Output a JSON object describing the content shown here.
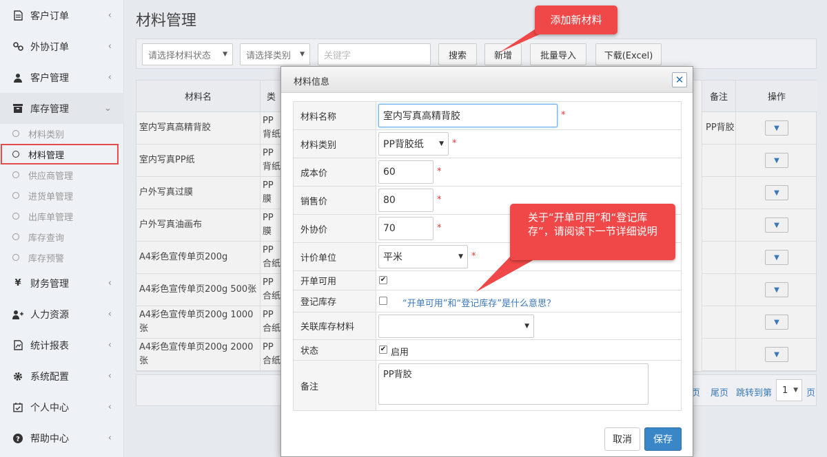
{
  "sidebar": {
    "items": [
      {
        "label": "客户订单",
        "icon": "document-icon"
      },
      {
        "label": "外协订单",
        "icon": "link-icon"
      },
      {
        "label": "客户管理",
        "icon": "user-icon"
      },
      {
        "label": "库存管理",
        "icon": "inventory-icon"
      },
      {
        "label": "财务管理",
        "icon": "yen-icon"
      },
      {
        "label": "人力资源",
        "icon": "user-add-icon"
      },
      {
        "label": "统计报表",
        "icon": "report-icon"
      },
      {
        "label": "系统配置",
        "icon": "gear-icon"
      },
      {
        "label": "个人中心",
        "icon": "calendar-check-icon"
      },
      {
        "label": "帮助中心",
        "icon": "question-icon"
      }
    ],
    "subitems": [
      "材料类别",
      "材料管理",
      "供应商管理",
      "进货单管理",
      "出库单管理",
      "库存查询",
      "库存预警"
    ]
  },
  "page": {
    "title": "材料管理"
  },
  "toolbar": {
    "status_select": "请选择材料状态",
    "category_select": "请选择类别",
    "keyword_placeholder": "关键字",
    "search": "搜索",
    "add": "新增",
    "import": "批量导入",
    "download": "下载(Excel)"
  },
  "table": {
    "headers": {
      "name": "材料名",
      "type": "类",
      "note": "备注",
      "action": "操作"
    },
    "rows": [
      {
        "name": "室内写真高精背胶",
        "type": "PP背纸",
        "note": "PP背胶"
      },
      {
        "name": "室内写真PP纸",
        "type": "PP背纸",
        "note": ""
      },
      {
        "name": "户外写真过膜",
        "type": "PP膜",
        "note": ""
      },
      {
        "name": "户外写真油画布",
        "type": "PP膜",
        "note": ""
      },
      {
        "name": "A4彩色宣传单页200g",
        "type": "PP合纸",
        "note": ""
      },
      {
        "name": "A4彩色宣传单页200g 500张",
        "type": "PP合纸",
        "note": ""
      },
      {
        "name": "A4彩色宣传单页200g 1000张",
        "type": "PP合纸",
        "note": ""
      },
      {
        "name": "A4彩色宣传单页200g 2000张",
        "type": "PP合纸",
        "note": ""
      }
    ]
  },
  "pager": {
    "page_fragment": "页",
    "last": "尾页",
    "jump": "跳转到第",
    "page_num": "1",
    "page_suffix": "页"
  },
  "modal": {
    "title": "材料信息",
    "fields": {
      "name_label": "材料名称",
      "name_value": "室内写真高精背胶",
      "category_label": "材料类别",
      "category_value": "PP背胶纸",
      "cost_label": "成本价",
      "cost_value": "60",
      "sale_label": "销售价",
      "sale_value": "80",
      "outsource_label": "外协价",
      "outsource_value": "70",
      "unit_label": "计价单位",
      "unit_value": "平米",
      "billable_label": "开单可用",
      "stock_label": "登记库存",
      "help_link": "“开单可用”和“登记库存”是什么意思？",
      "linked_label": "关联库存材料",
      "status_label": "状态",
      "status_value": "启用",
      "note_label": "备注",
      "note_value": "PP背胶",
      "required_mark": "*"
    },
    "cancel": "取消",
    "save": "保存"
  },
  "callouts": {
    "add_tip": "添加新材料",
    "help_tip": "关于“开单可用”和“登记库存”，请阅读下一节详细说明"
  },
  "colors": {
    "accent": "#3a87c8",
    "callout": "#f04848",
    "highlight": "#e84b4b",
    "link": "#3a78b8"
  }
}
